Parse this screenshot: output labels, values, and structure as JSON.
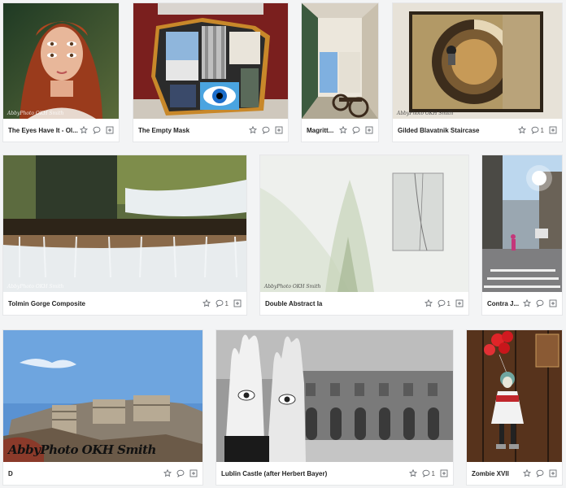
{
  "watermark_small": "AbbyPhoto OKH Smith",
  "watermark_large": "AbbyPhoto OKH Smith",
  "photos": [
    {
      "title": "The Eyes Have It - Ol...",
      "comments": "",
      "has_count": false
    },
    {
      "title": "The Empty Mask",
      "comments": "",
      "has_count": false
    },
    {
      "title": "Magritt...",
      "comments": "",
      "has_count": false
    },
    {
      "title": "Gilded Blavatnik Staircase",
      "comments": "1",
      "has_count": true
    },
    {
      "title": "Tolmin Gorge Composite",
      "comments": "1",
      "has_count": true
    },
    {
      "title": "Double Abstract Ia",
      "comments": "1",
      "has_count": true
    },
    {
      "title": "Contra J...",
      "comments": "",
      "has_count": false
    },
    {
      "title": "D",
      "comments": "",
      "has_count": false
    },
    {
      "title": "Lublin Castle (after Herbert Bayer)",
      "comments": "1",
      "has_count": true
    },
    {
      "title": "Zombie XVII",
      "comments": "",
      "has_count": false
    }
  ],
  "colors": {
    "background": "#f3f4f5",
    "card": "#ffffff",
    "icon": "#6b6f75",
    "title": "#222222"
  },
  "icons": {
    "like": "star-icon",
    "comment": "comment-bubble-icon",
    "add": "add-to-gallery-icon"
  }
}
